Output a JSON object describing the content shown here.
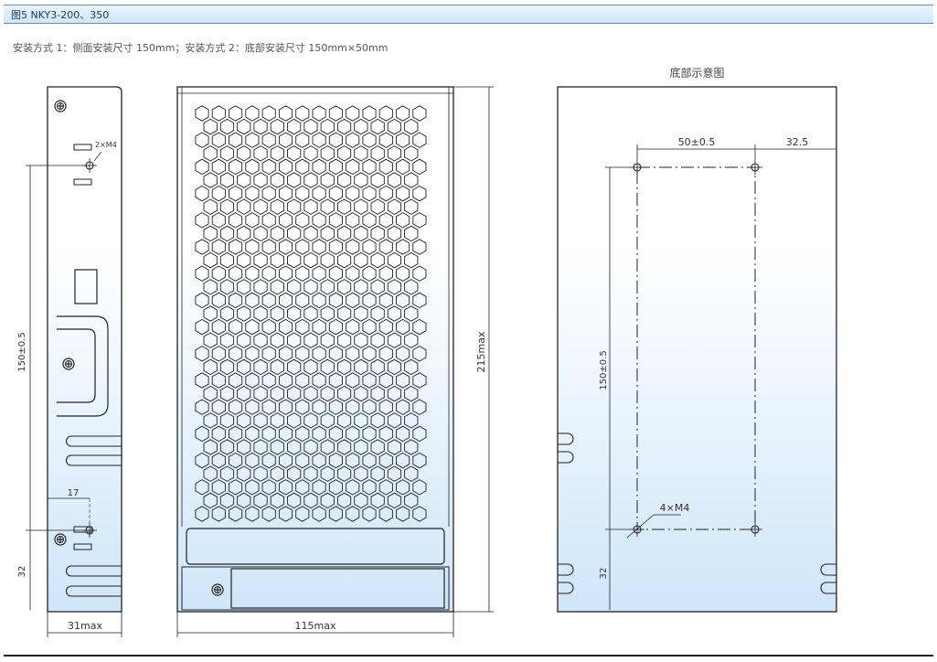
{
  "header": {
    "title": "图5 NKY3-200、350"
  },
  "subtitle": "安装方式 1：侧面安装尺寸 150mm；安装方式 2：底部安装尺寸 150mm×50mm",
  "bottom_view_caption": "底部示意图",
  "side_view": {
    "hole_label": "2×M4",
    "dim_vertical": "150±0.5",
    "dim_offset": "17",
    "dim_bottom": "32",
    "dim_width": "31max"
  },
  "front_view": {
    "dim_height": "215max",
    "dim_width": "115max"
  },
  "bottom_view": {
    "dim_hole_spacing": "50±0.5",
    "dim_edge": "32.5",
    "dim_vertical": "150±0.5",
    "hole_label": "4×M4",
    "dim_bottom": "32"
  },
  "colors": {
    "accent": "#5a8fbf",
    "fill": "#cfe6f9"
  }
}
